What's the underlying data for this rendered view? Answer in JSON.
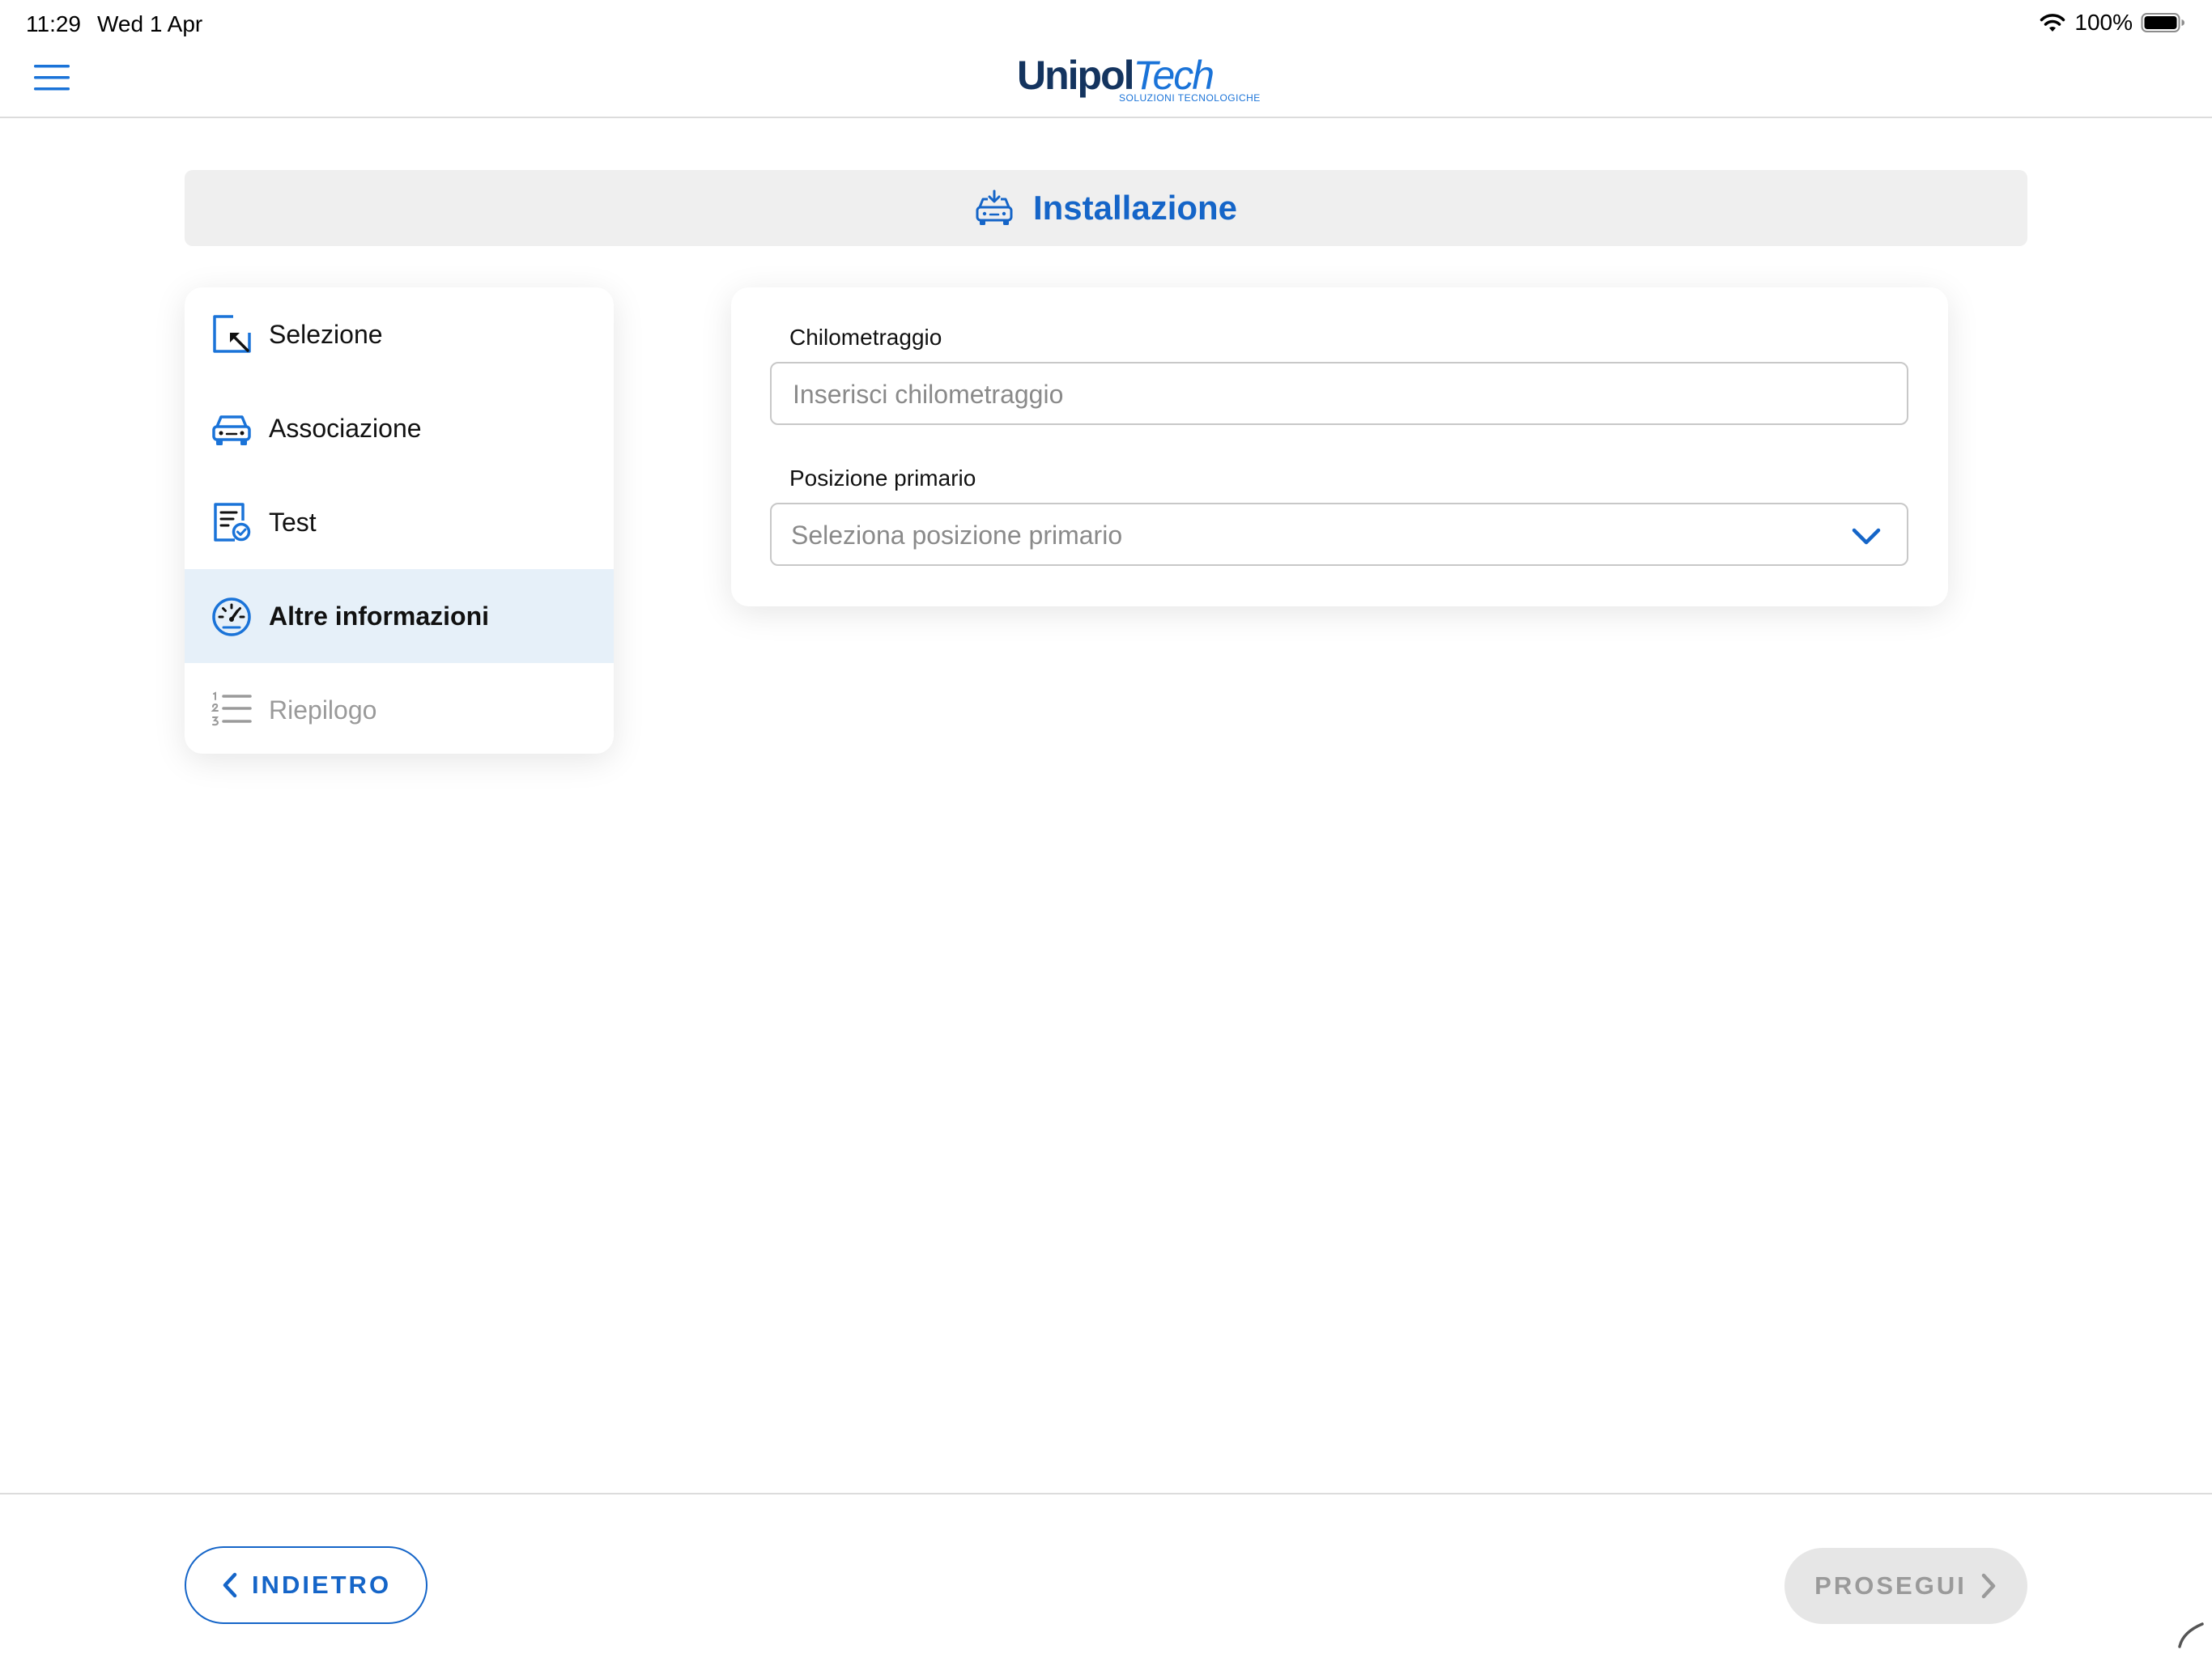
{
  "status_bar": {
    "time": "11:29",
    "date": "Wed 1 Apr",
    "battery": "100%"
  },
  "header": {
    "logo_primary": "Unipol",
    "logo_secondary": "Tech",
    "logo_tagline": "SOLUZIONI TECNOLOGICHE"
  },
  "title": {
    "text": "Installazione",
    "icon": "car-install-icon"
  },
  "steps": [
    {
      "label": "Selezione",
      "icon": "select-cursor-icon",
      "state": "completed"
    },
    {
      "label": "Associazione",
      "icon": "car-icon",
      "state": "completed"
    },
    {
      "label": "Test",
      "icon": "document-check-icon",
      "state": "completed"
    },
    {
      "label": "Altre informazioni",
      "icon": "speedometer-icon",
      "state": "active"
    },
    {
      "label": "Riepilogo",
      "icon": "numbered-list-icon",
      "state": "disabled"
    }
  ],
  "form": {
    "mileage": {
      "label": "Chilometraggio",
      "placeholder": "Inserisci chilometraggio",
      "value": ""
    },
    "primary_position": {
      "label": "Posizione primario",
      "placeholder": "Seleziona posizione primario"
    }
  },
  "footer": {
    "back_label": "INDIETRO",
    "next_label": "PROSEGUI"
  },
  "colors": {
    "accent": "#1565c8",
    "active_step_bg": "#e6f0f9",
    "banner_bg": "#efefef",
    "disabled_text": "#9a9a9a"
  }
}
